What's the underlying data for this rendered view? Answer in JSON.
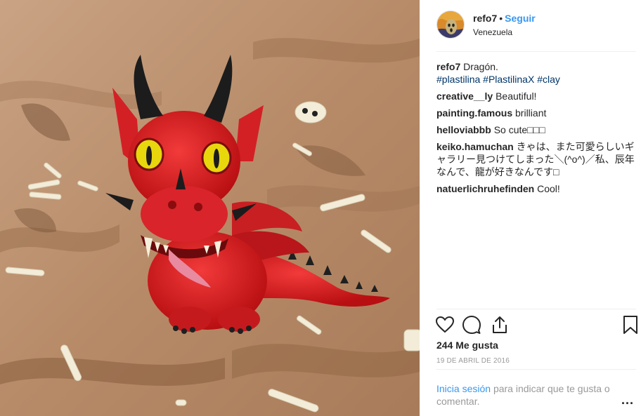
{
  "post": {
    "username": "refo7",
    "separator": "•",
    "follow_label": "Seguir",
    "location": "Venezuela"
  },
  "caption": {
    "username": "refo7",
    "text": "Dragón.",
    "hashtags": "#plastilina #PlastilinaX #clay"
  },
  "comments": [
    {
      "user": "creative__ly",
      "text": "Beautiful!"
    },
    {
      "user": "painting.famous",
      "text": "brilliant"
    },
    {
      "user": "helloviabbb",
      "text": "So cute□□□"
    },
    {
      "user": "keiko.hamuchan",
      "text": "きゃは、また可愛らしいギャラリー見つけてしまった＼(^o^)／私、辰年なんで、龍が好きなんです□"
    },
    {
      "user": "natuerlichruhefinden",
      "text": "Cool!"
    }
  ],
  "actions": {
    "like_icon": "heart-icon",
    "comment_icon": "comment-icon",
    "share_icon": "share-icon",
    "save_icon": "bookmark-icon"
  },
  "likes": "244 Me gusta",
  "date": "19 DE ABRIL DE 2016",
  "login_prompt": {
    "link": "Inicia sesión",
    "rest": "para indicar que te gusta o comentar."
  },
  "more_label": "..."
}
